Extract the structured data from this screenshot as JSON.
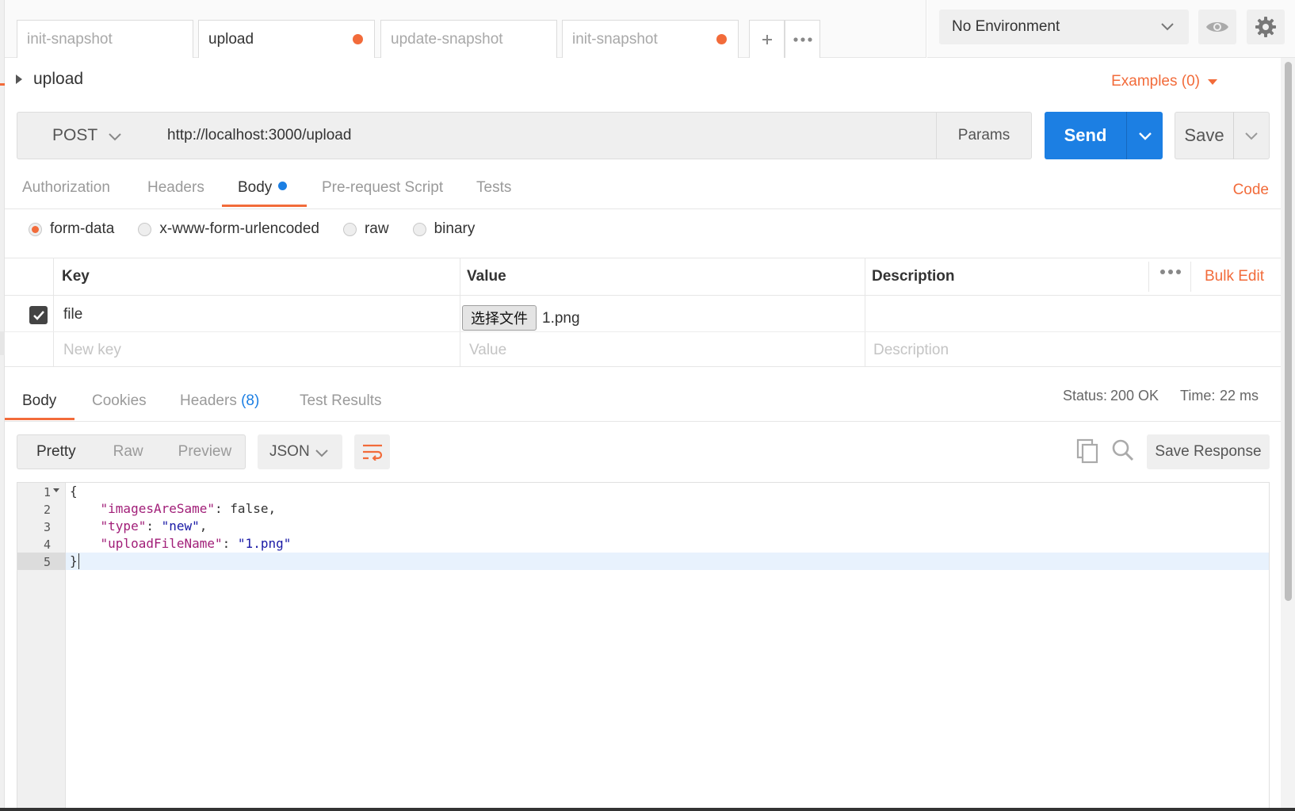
{
  "top_tabs": [
    {
      "label": "init-snapshot",
      "unsaved": false
    },
    {
      "label": "upload",
      "unsaved": true
    },
    {
      "label": "update-snapshot",
      "unsaved": false
    },
    {
      "label": "init-snapshot",
      "unsaved": true
    }
  ],
  "environment": {
    "selected": "No Environment"
  },
  "request": {
    "name": "upload",
    "examples_label": "Examples (0)",
    "method": "POST",
    "url": "http://localhost:3000/upload",
    "params_label": "Params",
    "send_label": "Send",
    "save_label": "Save"
  },
  "request_tabs": [
    "Authorization",
    "Headers",
    "Body",
    "Pre-request Script",
    "Tests"
  ],
  "code_label": "Code",
  "body_types": [
    "form-data",
    "x-www-form-urlencoded",
    "raw",
    "binary"
  ],
  "form_table": {
    "headers": {
      "key": "Key",
      "value": "Value",
      "description": "Description"
    },
    "bulk_edit": "Bulk Edit",
    "rows": [
      {
        "checked": true,
        "key": "file",
        "file_button": "选择文件",
        "file_name": "1.png"
      }
    ],
    "placeholders": {
      "key": "New key",
      "value": "Value",
      "description": "Description"
    }
  },
  "response_tabs": {
    "body": "Body",
    "cookies": "Cookies",
    "headers": "Headers",
    "headers_count": "(8)",
    "tests": "Test Results"
  },
  "response_status": {
    "status_label": "Status:",
    "status_value": "200 OK",
    "time_label": "Time:",
    "time_value": "22 ms"
  },
  "view_modes": [
    "Pretty",
    "Raw",
    "Preview"
  ],
  "format": "JSON",
  "save_response_label": "Save Response",
  "code_lines": {
    "l1": "{",
    "l2_key": "\"imagesAreSame\"",
    "l2_val": ": false,",
    "l3_key": "\"type\"",
    "l3_sep": ": ",
    "l3_val": "\"new\"",
    "l3_end": ",",
    "l4_key": "\"uploadFileName\"",
    "l4_sep": ": ",
    "l4_val": "\"1.png\"",
    "l5": "}"
  },
  "line_numbers": [
    "1",
    "2",
    "3",
    "4",
    "5"
  ],
  "colors": {
    "accent": "#f26b3a",
    "primary": "#1c7fe3"
  }
}
